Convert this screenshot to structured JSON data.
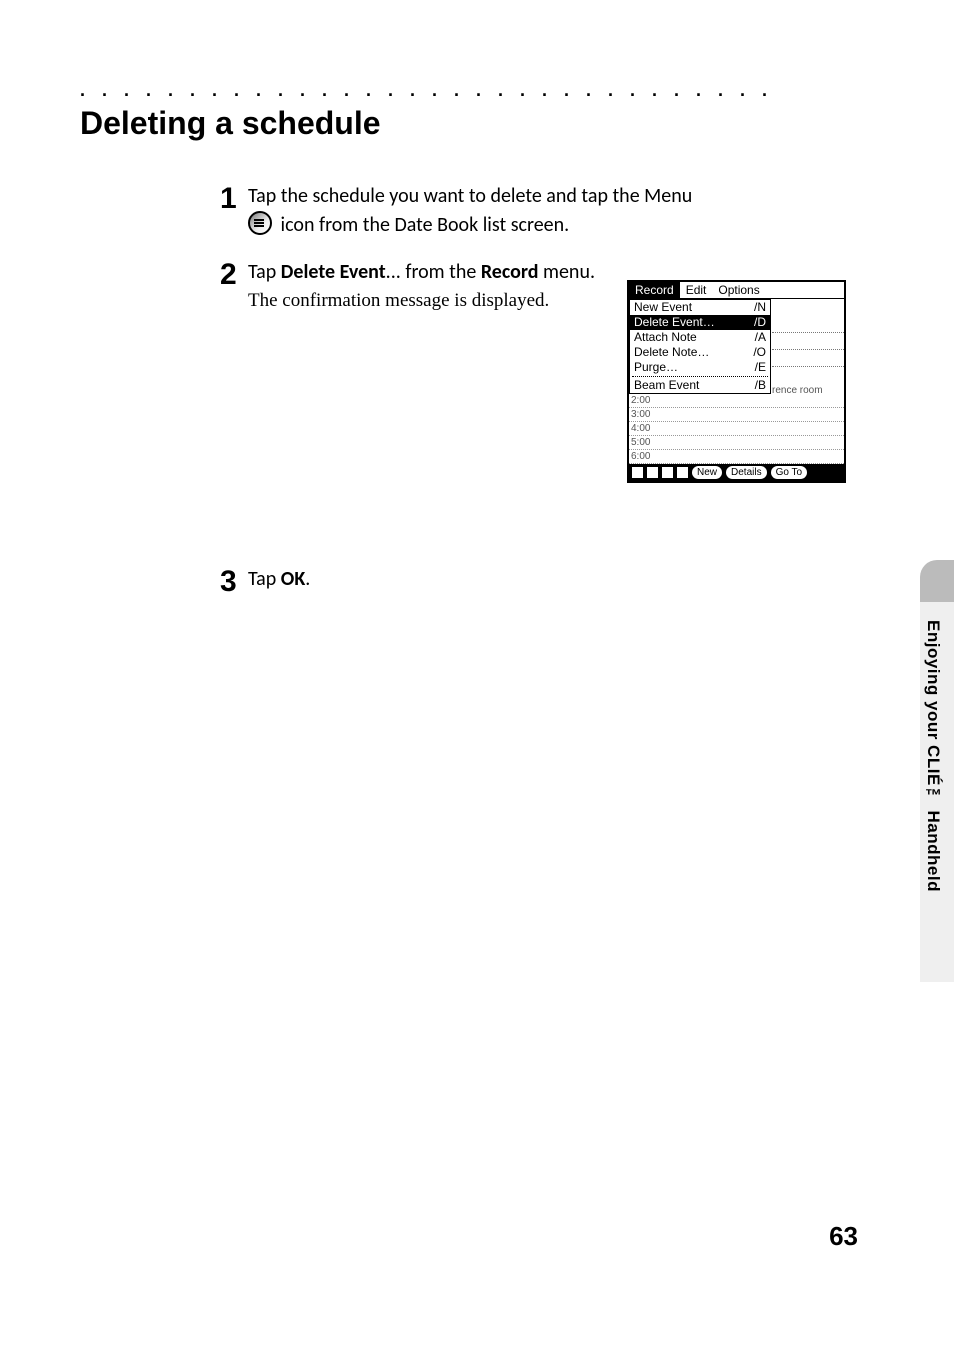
{
  "heading": "Deleting a schedule",
  "steps": [
    {
      "num": "1",
      "line1_a": "Tap the schedule you want to delete and tap the Menu",
      "line1_b": " icon from the Date Book list screen."
    },
    {
      "num": "2",
      "line_a": "Tap ",
      "bold_a": "Delete Event",
      "line_b": "... from the ",
      "bold_b": "Record",
      "line_c": " menu.",
      "sub": "The confirmation message is displayed."
    },
    {
      "num": "3",
      "line_a": "Tap ",
      "bold_a": "OK",
      "line_b": "."
    }
  ],
  "screenshot": {
    "menubar": {
      "record": "Record",
      "edit": "Edit",
      "options": "Options"
    },
    "dropdown": [
      {
        "label": "New Event",
        "shortcut": "/N",
        "sel": false
      },
      {
        "label": "Delete Event…",
        "shortcut": "/D",
        "sel": true
      },
      {
        "label": "Attach Note",
        "shortcut": "/A",
        "sel": false
      },
      {
        "label": "Delete Note…",
        "shortcut": "/O",
        "sel": false
      },
      {
        "label": "Purge…",
        "shortcut": "/E",
        "sel": false
      },
      {
        "label": "Beam Event",
        "shortcut": "/B",
        "sel": false
      }
    ],
    "rightlines": [
      "",
      "",
      "",
      "",
      "rence room"
    ],
    "timelines": [
      "2:00",
      "3:00",
      "4:00",
      "5:00",
      "6:00"
    ],
    "footer": {
      "new": "New",
      "details": "Details",
      "goto": "Go To"
    }
  },
  "sidetab_label": "Enjoying your CLIÉ™ Handheld",
  "page_number": "63"
}
